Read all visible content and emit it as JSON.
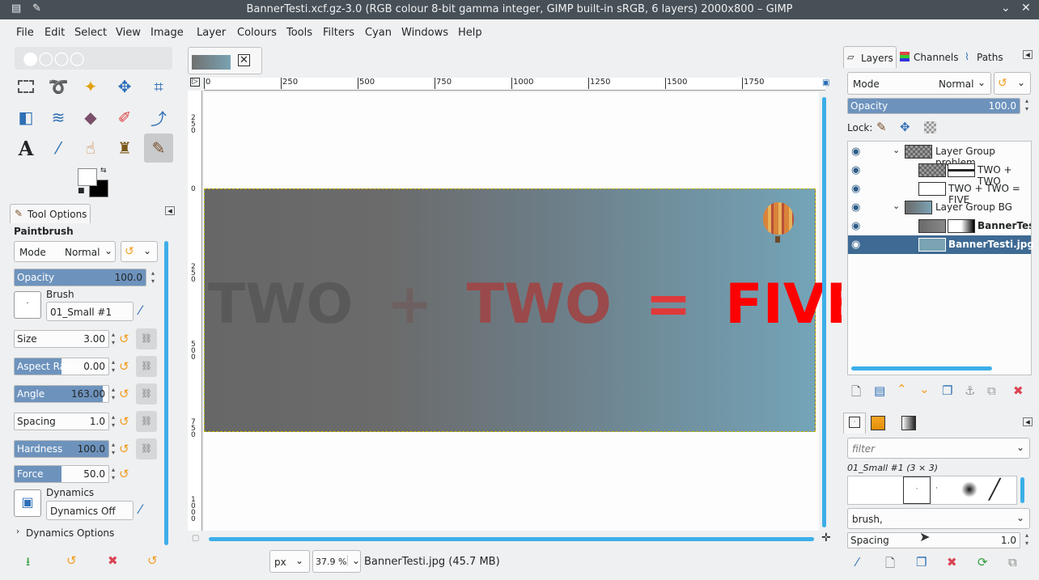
{
  "window": {
    "title": "BannerTesti.xcf.gz-3.0 (RGB colour 8-bit gamma integer, GIMP built-in sRGB, 6 layers) 2000x800 – GIMP"
  },
  "menu": [
    "File",
    "Edit",
    "Select",
    "View",
    "Image",
    "Layer",
    "Colours",
    "Tools",
    "Filters",
    "Cyan",
    "Windows",
    "Help"
  ],
  "tool_options": {
    "tab": "Tool Options",
    "tool": "Paintbrush",
    "mode_label": "Mode",
    "mode_value": "Normal",
    "opacity_label": "Opacity",
    "opacity_value": "100.0",
    "opacity_fraction": 1.0,
    "brush_label": "Brush",
    "brush_value": "01_Small #1",
    "sliders": [
      {
        "label": "Size",
        "value": "3.00",
        "fraction": 0.0
      },
      {
        "label": "Aspect Ratio",
        "value": "0.00",
        "fraction": 0.5
      },
      {
        "label": "Angle",
        "value": "163.00",
        "fraction": 0.94
      },
      {
        "label": "Spacing",
        "value": "1.0",
        "fraction": 0.0
      },
      {
        "label": "Hardness",
        "value": "100.0",
        "fraction": 1.0
      },
      {
        "label": "Force",
        "value": "50.0",
        "fraction": 0.5
      }
    ],
    "dynamics_label": "Dynamics",
    "dynamics_value": "Dynamics Off",
    "dynamics_options": "Dynamics Options"
  },
  "canvas": {
    "ruler_h": [
      "0",
      "250",
      "500",
      "750",
      "1000",
      "1250",
      "1500",
      "1750"
    ],
    "ruler_v": [
      "0",
      "250",
      "500",
      "750",
      "1000"
    ],
    "ruler_v_top": "250",
    "banner_parts": [
      {
        "text": "TWO",
        "color": "#595959"
      },
      {
        "text": "+",
        "color": "#6e6060"
      },
      {
        "text": "TWO",
        "color": "#9a4a4a"
      },
      {
        "text": "=",
        "color": "#e0393a"
      },
      {
        "text": "FIVE",
        "color": "#ff0000"
      }
    ],
    "unit": "px",
    "zoom": "37.9 %",
    "status": "BannerTesti.jpg (45.7 MB)"
  },
  "layers_panel": {
    "tabs": [
      "Layers",
      "Channels",
      "Paths"
    ],
    "mode_label": "Mode",
    "mode_value": "Normal",
    "opacity_label": "Opacity",
    "opacity_value": "100.0",
    "lock_label": "Lock:",
    "layers": [
      {
        "name": "Layer Group problem",
        "bold": false
      },
      {
        "name": "TWO + TWO",
        "bold": false
      },
      {
        "name": "TWO + TWO = FIVE",
        "bold": false
      },
      {
        "name": "Layer Group BG",
        "bold": false
      },
      {
        "name": "BannerTesti",
        "bold": true
      },
      {
        "name": "BannerTesti.jpg",
        "bold": true,
        "selected": true
      }
    ]
  },
  "brushes_panel": {
    "filter_placeholder": "filter",
    "brush_info": "01_Small #1 (3 × 3)",
    "tag_value": "brush,",
    "spacing_label": "Spacing",
    "spacing_value": "1.0"
  }
}
